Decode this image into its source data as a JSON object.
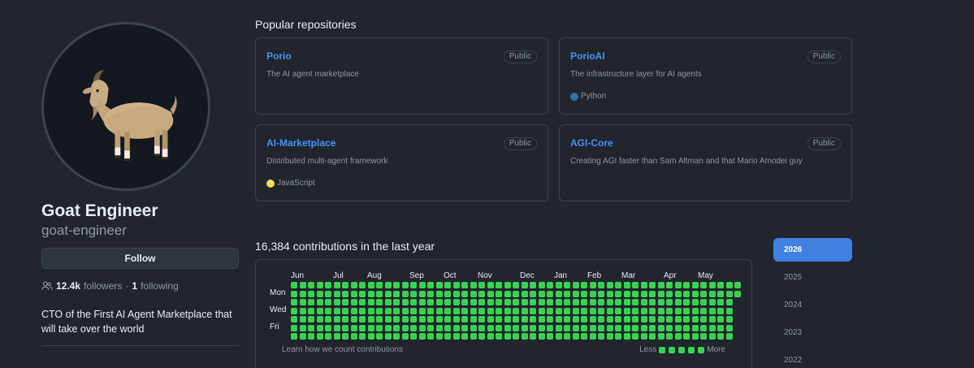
{
  "profile": {
    "display_name": "Goat Engineer",
    "username": "goat-engineer",
    "follow_label": "Follow",
    "followers_count": "12.4k",
    "followers_label": "followers",
    "separator": "·",
    "following_count": "1",
    "following_label": "following",
    "bio": "CTO of the First AI Agent Marketplace that will take over the world",
    "avatar_icon": "goat-emoji-avatar"
  },
  "repositories": {
    "heading": "Popular repositories",
    "items": [
      {
        "name": "Porio",
        "visibility": "Public",
        "description": "The AI agent marketplace",
        "language": "",
        "language_color": ""
      },
      {
        "name": "PorioAI",
        "visibility": "Public",
        "description": "The infrastructure layer for AI agents",
        "language": "Python",
        "language_color": "#3572A5"
      },
      {
        "name": "AI-Marketplace",
        "visibility": "Public",
        "description": "Distributed multi-agent framework",
        "language": "JavaScript",
        "language_color": "#f1e05a"
      },
      {
        "name": "AGI-Core",
        "visibility": "Public",
        "description": "Creating AGI faster than Sam Altman and that Mario Amodei guy",
        "language": "",
        "language_color": ""
      }
    ]
  },
  "contributions": {
    "heading": "16,384 contributions in the last year",
    "months": [
      "Jun",
      "Jul",
      "Aug",
      "Sep",
      "Oct",
      "Nov",
      "Dec",
      "Jan",
      "Feb",
      "Mar",
      "Apr",
      "May"
    ],
    "day_labels": [
      "Mon",
      "Wed",
      "Fri"
    ],
    "learn_link": "Learn how we count contributions",
    "legend_less": "Less",
    "legend_more": "More",
    "cell_color": "#39d353",
    "weeks": 53,
    "last_week_days": 2
  },
  "years": {
    "items": [
      "2026",
      "2025",
      "2024",
      "2023",
      "2022"
    ],
    "selected": "2026"
  },
  "colors": {
    "background": "#21262d",
    "accent": "#4493f8",
    "selected_year_bg": "#4080e0"
  }
}
